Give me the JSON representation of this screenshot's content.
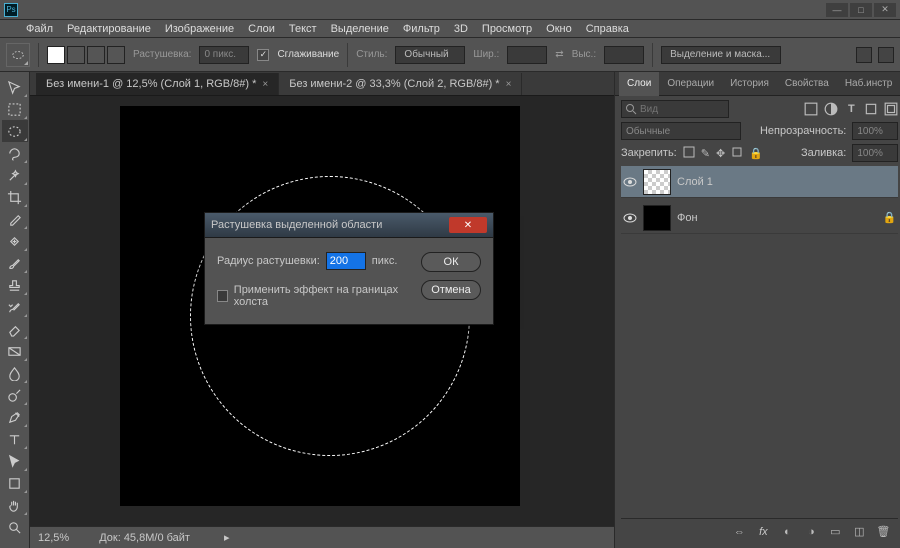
{
  "menu": [
    "Файл",
    "Редактирование",
    "Изображение",
    "Слои",
    "Текст",
    "Выделение",
    "Фильтр",
    "3D",
    "Просмотр",
    "Окно",
    "Справка"
  ],
  "options": {
    "feather_label": "Растушевка:",
    "feather_value": "0 пикс.",
    "antialias": "Сглаживание",
    "style_label": "Стиль:",
    "style_value": "Обычный",
    "width_label": "Шир.:",
    "height_label": "Выс.:",
    "select_mask": "Выделение и маска..."
  },
  "tabs": [
    {
      "label": "Без имени-1 @ 12,5% (Слой 1, RGB/8#) *",
      "active": true
    },
    {
      "label": "Без имени-2 @ 33,3% (Слой 2, RGB/8#) *",
      "active": false
    }
  ],
  "status": {
    "zoom": "12,5%",
    "doc": "Док: 45,8M/0 байт"
  },
  "panels": {
    "tabs": [
      "Слои",
      "Операции",
      "История",
      "Свойства",
      "Наб.инстр"
    ],
    "search_placeholder": "Вид",
    "blend": "Обычные",
    "opacity_label": "Непрозрачность:",
    "opacity": "100%",
    "lock_label": "Закрепить:",
    "fill_label": "Заливка:",
    "fill": "100%",
    "layers": [
      {
        "name": "Слой 1",
        "selected": true,
        "locked": false,
        "transparent": true
      },
      {
        "name": "Фон",
        "selected": false,
        "locked": true,
        "transparent": false
      }
    ]
  },
  "dialog": {
    "title": "Растушевка выделенной области",
    "radius_label": "Радиус растушевки:",
    "radius_value": "200",
    "unit": "пикс.",
    "apply_edges": "Применить эффект на границах холста",
    "ok": "ОК",
    "cancel": "Отмена"
  }
}
